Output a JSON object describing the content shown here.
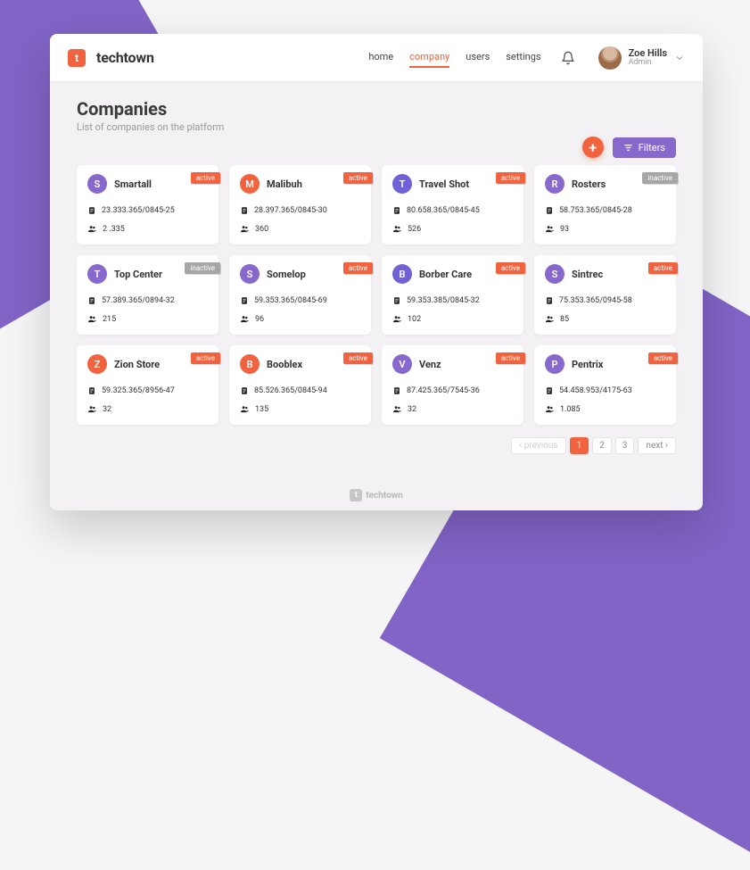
{
  "brand": {
    "letter": "t",
    "name": "techtown"
  },
  "nav": {
    "items": [
      "home",
      "company",
      "users",
      "settings"
    ],
    "active_index": 1
  },
  "user": {
    "name": "Zoe Hills",
    "role": "Admin"
  },
  "page": {
    "title": "Companies",
    "subtitle": "List of companies on the platform"
  },
  "toolbar": {
    "filters_label": "Filters",
    "add_label": "+"
  },
  "avatar_colors": {
    "purple": "#8768cc",
    "orange": "#f1633f",
    "blurple": "#7061d6"
  },
  "companies": [
    {
      "letter": "S",
      "name": "Smartall",
      "status": "active",
      "code": "23.333.365/0845-25",
      "count": "2 .335",
      "color": "purple"
    },
    {
      "letter": "M",
      "name": "Malibuh",
      "status": "active",
      "code": "28.397.365/0845-30",
      "count": "360",
      "color": "orange"
    },
    {
      "letter": "T",
      "name": "Travel Shot",
      "status": "active",
      "code": "80.658.365/0845-45",
      "count": "526",
      "color": "blurple"
    },
    {
      "letter": "R",
      "name": "Rosters",
      "status": "inactive",
      "code": "58.753.365/0845-28",
      "count": "93",
      "color": "purple"
    },
    {
      "letter": "T",
      "name": "Top Center",
      "status": "inactive",
      "code": "57.389.365/0894-32",
      "count": "215",
      "color": "purple"
    },
    {
      "letter": "S",
      "name": "Somelop",
      "status": "active",
      "code": "59.353.365/0845-69",
      "count": "96",
      "color": "purple"
    },
    {
      "letter": "B",
      "name": "Borber Care",
      "status": "active",
      "code": "59.353.385/0845-32",
      "count": "102",
      "color": "blurple"
    },
    {
      "letter": "S",
      "name": "Sintrec",
      "status": "active",
      "code": "75.353.365/0945-58",
      "count": "85",
      "color": "purple"
    },
    {
      "letter": "Z",
      "name": "Zion Store",
      "status": "active",
      "code": "59.325.365/8956-47",
      "count": "32",
      "color": "orange"
    },
    {
      "letter": "B",
      "name": "Booblex",
      "status": "active",
      "code": "85.526.365/0845-94",
      "count": "135",
      "color": "orange"
    },
    {
      "letter": "V",
      "name": "Venz",
      "status": "active",
      "code": "87.425.365/7545-36",
      "count": "32",
      "color": "purple"
    },
    {
      "letter": "P",
      "name": "Pentrix",
      "status": "active",
      "code": "54.458.953/4175-63",
      "count": "1.085",
      "color": "purple"
    }
  ],
  "pagination": {
    "prev_label": "previous",
    "next_label": "next",
    "pages": [
      "1",
      "2",
      "3"
    ],
    "current_index": 0
  },
  "footer": {
    "letter": "t",
    "name": "techtown"
  }
}
